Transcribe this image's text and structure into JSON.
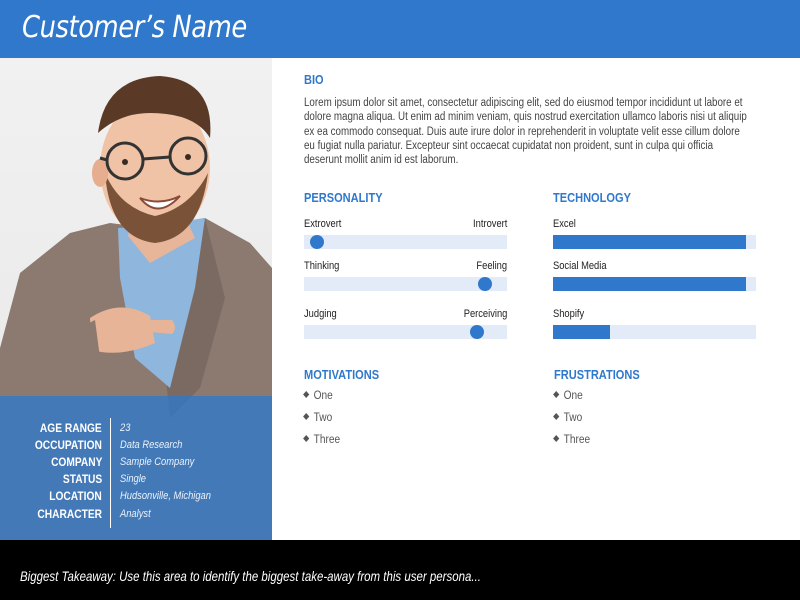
{
  "header": {
    "title": "Customer’s Name"
  },
  "profile": {
    "rows": [
      {
        "key": "AGE RANGE",
        "value": "23"
      },
      {
        "key": "OCCUPATION",
        "value": "Data Research"
      },
      {
        "key": "COMPANY",
        "value": "Sample Company"
      },
      {
        "key": "STATUS",
        "value": "Single"
      },
      {
        "key": "LOCATION",
        "value": "Hudsonville, Michigan"
      },
      {
        "key": "CHARACTER",
        "value": "Analyst"
      }
    ]
  },
  "bio": {
    "title": "BIO",
    "text": "Lorem ipsum dolor sit amet, consectetur adipiscing elit, sed do eiusmod tempor incididunt ut labore et dolore magna aliqua. Ut enim ad minim veniam, quis nostrud exercitation ullamco laboris nisi ut aliquip ex ea commodo consequat. Duis aute irure dolor in reprehenderit in voluptate velit esse cillum dolore eu fugiat nulla pariatur. Excepteur sint occaecat cupidatat non proident, sunt in culpa qui officia deserunt mollit anim id est laborum."
  },
  "personality": {
    "title": "PERSONALITY",
    "traits": [
      {
        "left": "Extrovert",
        "right": "Introvert",
        "value": 0.03
      },
      {
        "left": "Thinking",
        "right": "Feeling",
        "value": 0.92
      },
      {
        "left": "Judging",
        "right": "Perceiving",
        "value": 0.88
      }
    ]
  },
  "technology": {
    "title": "TECHNOLOGY",
    "items": [
      {
        "label": "Excel",
        "value": 0.95
      },
      {
        "label": "Social Media",
        "value": 0.95
      },
      {
        "label": "Shopify",
        "value": 0.28
      }
    ]
  },
  "motivations": {
    "title": "MOTIVATIONS",
    "items": [
      "One",
      "Two",
      "Three"
    ]
  },
  "frustrations": {
    "title": "FRUSTRATIONS",
    "items": [
      "One",
      "Two",
      "Three"
    ]
  },
  "footer": {
    "text": "Biggest Takeaway: Use this area to identify the biggest take-away from this user persona..."
  },
  "colors": {
    "accent": "#2f78cc",
    "track": "#e3ebf8",
    "footer": "#000000"
  }
}
